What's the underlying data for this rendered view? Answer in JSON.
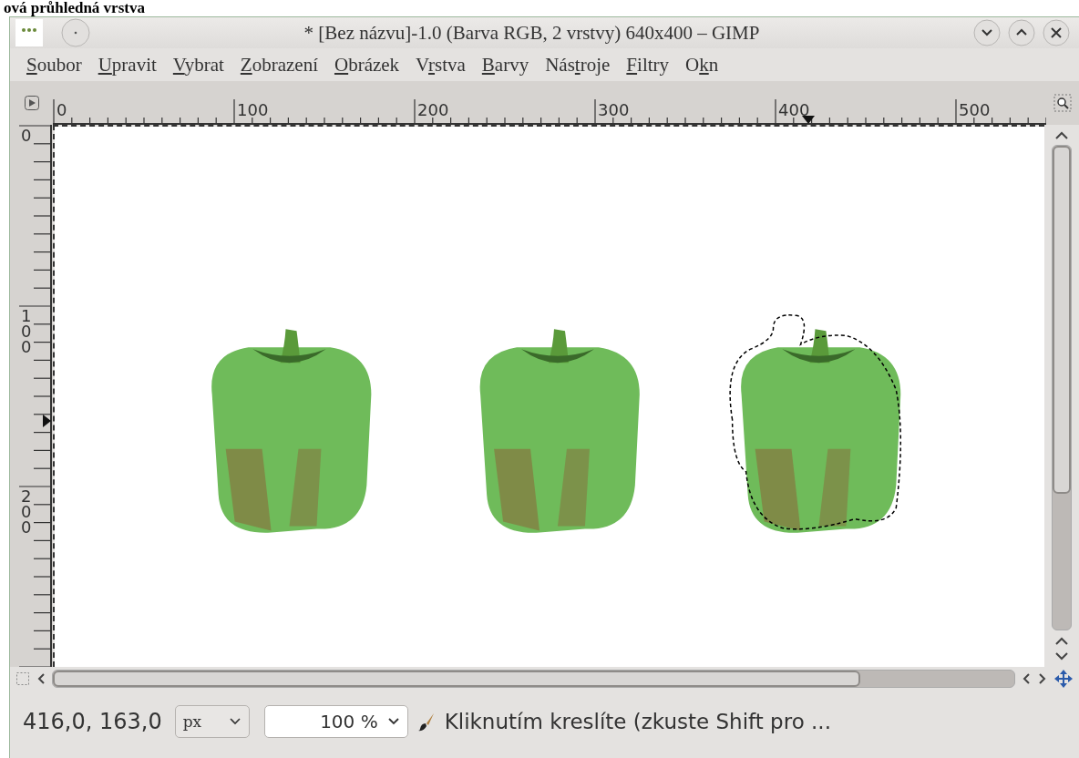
{
  "page_heading": "ová průhledná vrstva",
  "window": {
    "title": "* [Bez názvu]-1.0 (Barva RGB, 2 vrstvy) 640x400 – GIMP"
  },
  "menu": [
    {
      "key": "S",
      "post": "oubor"
    },
    {
      "key": "U",
      "post": "pravit"
    },
    {
      "key": "V",
      "post": "ybrat"
    },
    {
      "key": "Z",
      "post": "obrazení"
    },
    {
      "key": "O",
      "post": "brázek"
    },
    {
      "pre": "V",
      "key": "r",
      "post": "stva"
    },
    {
      "key": "B",
      "post": "arvy"
    },
    {
      "pre": "Nás",
      "key": "t",
      "post": "roje"
    },
    {
      "key": "F",
      "post": "iltry"
    },
    {
      "pre": "O",
      "key": "k",
      "post": "n"
    }
  ],
  "rulers": {
    "horizontal": [
      "0",
      "100",
      "200",
      "300",
      "400",
      "500"
    ],
    "vertical": [
      "0",
      "100",
      "200"
    ]
  },
  "status_bar": {
    "coordinates": "416,0, 163,0",
    "unit": "px",
    "zoom": "100 %",
    "message": "Kliknutím kreslíte (zkuste Shift pro ..."
  }
}
